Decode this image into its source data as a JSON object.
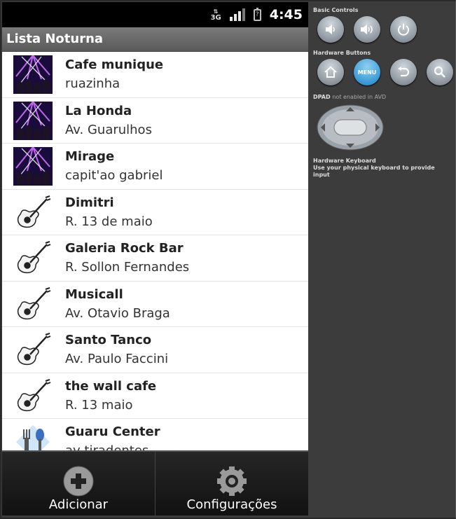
{
  "status": {
    "network": "3G",
    "time": "4:45"
  },
  "app": {
    "title": "Lista Noturna"
  },
  "items": [
    {
      "name": "Cafe munique",
      "address": "ruazinha",
      "icon": "party-icon"
    },
    {
      "name": "La Honda",
      "address": "Av. Guarulhos",
      "icon": "party-icon"
    },
    {
      "name": "Mirage",
      "address": "capit'ao gabriel",
      "icon": "party-icon"
    },
    {
      "name": "Dimitri",
      "address": "R. 13 de maio",
      "icon": "guitar-icon"
    },
    {
      "name": "Galeria Rock Bar",
      "address": "R. Sollon Fernandes",
      "icon": "guitar-icon"
    },
    {
      "name": "Musicall",
      "address": "Av. Otavio Braga",
      "icon": "guitar-icon"
    },
    {
      "name": "Santo Tanco",
      "address": "Av. Paulo Faccini",
      "icon": "guitar-icon"
    },
    {
      "name": "the wall cafe",
      "address": "R. 13 maio",
      "icon": "guitar-icon"
    },
    {
      "name": "Guaru Center",
      "address": "av tiradentes",
      "icon": "food-icon"
    }
  ],
  "bottom": {
    "add_label": "Adicionar",
    "settings_label": "Configurações"
  },
  "emulator": {
    "basic_controls": "Basic Controls",
    "hardware_buttons": "Hardware Buttons",
    "menu_label": "MENU",
    "dpad_label": "DPAD",
    "dpad_note": "not enabled in AVD",
    "keyboard_title": "Hardware Keyboard",
    "keyboard_note": "Use your physical keyboard to provide input"
  }
}
